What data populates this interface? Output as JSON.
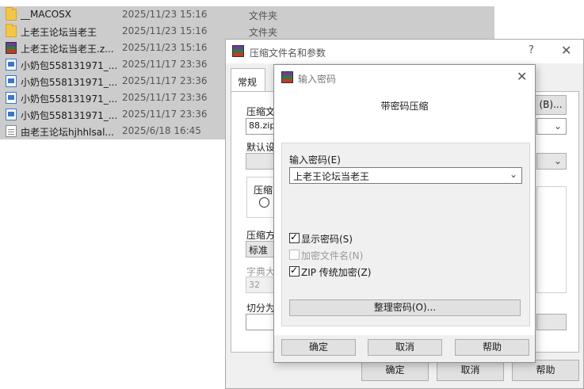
{
  "explorer": {
    "files": [
      {
        "name": "__MACOSX",
        "date": "2025/11/23 15:16",
        "type": "文件夹",
        "icon": "folder-icon"
      },
      {
        "name": "上老王论坛当老王",
        "date": "2025/11/23 15:16",
        "type": "文件夹",
        "icon": "folder-icon"
      },
      {
        "name": "上老王论坛当老王.z...",
        "date": "2025/11/23 15:16",
        "type": "",
        "icon": "winrar-archive-icon"
      },
      {
        "name": "小奶包558131971_...",
        "date": "2025/11/17 23:36",
        "type": "",
        "icon": "image-file-icon"
      },
      {
        "name": "小奶包558131971_...",
        "date": "2025/11/17 23:36",
        "type": "",
        "icon": "image-file-icon"
      },
      {
        "name": "小奶包558131971_...",
        "date": "2025/11/17 23:36",
        "type": "",
        "icon": "image-file-icon"
      },
      {
        "name": "小奶包558131971_...",
        "date": "2025/11/17 23:36",
        "type": "",
        "icon": "image-file-icon"
      },
      {
        "name": "由老王论坛hjhhlsal...",
        "date": "2025/6/18 16:45",
        "type": "",
        "icon": "text-file-icon"
      }
    ]
  },
  "compress_dialog": {
    "title": "压缩文件名和参数",
    "help_button": "?",
    "close_button": "✕",
    "tab_general": "常规",
    "archive_name_label": "压缩文",
    "archive_name_value": "88.zip",
    "browse_button": "(B)...",
    "default_profile_label": "默认设",
    "format_label": "压缩",
    "compression_method_label": "压缩方",
    "compression_method_value": "标准",
    "dictionary_label": "字典大",
    "dictionary_value": "32",
    "split_label": "切分为",
    "ok_button": "确定",
    "cancel_button": "取消",
    "help_text_button": "帮助"
  },
  "password_dialog": {
    "title": "输入密码",
    "close_button": "✕",
    "heading": "带密码压缩",
    "password_label": "输入密码(E)",
    "password_value": "上老王论坛当老王",
    "show_password": {
      "label": "显示密码(S)",
      "checked": true,
      "enabled": true
    },
    "encrypt_filenames": {
      "label": "加密文件名(N)",
      "checked": false,
      "enabled": false
    },
    "zip_legacy": {
      "label": "ZIP 传统加密(Z)",
      "checked": true,
      "enabled": true
    },
    "organize_button": "整理密码(O)...",
    "ok_button": "确定",
    "cancel_button": "取消",
    "help_button": "帮助"
  },
  "colors": {
    "selection": "#cccccc",
    "dialog_bg": "#f0f0f0",
    "button_bg": "#e1e1e1"
  }
}
